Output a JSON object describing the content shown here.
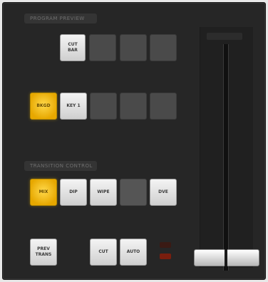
{
  "sections": {
    "top_label": "PROGRAM PREVIEW",
    "lower_label": "TRANSITION CONTROL"
  },
  "rows": {
    "row1": [
      {
        "label": "CUT\nBAR",
        "state": "lit"
      },
      {
        "label": "",
        "state": "dim"
      },
      {
        "label": "",
        "state": "dim"
      },
      {
        "label": "",
        "state": "dim"
      }
    ],
    "row2": [
      {
        "label": "BKGD",
        "state": "yellow"
      },
      {
        "label": "KEY 1",
        "state": "lit"
      },
      {
        "label": "",
        "state": "dim"
      },
      {
        "label": "",
        "state": "dim"
      },
      {
        "label": "",
        "state": "dim"
      }
    ],
    "row3": [
      {
        "label": "MIX",
        "state": "yellow"
      },
      {
        "label": "DIP",
        "state": "lit"
      },
      {
        "label": "WIPE",
        "state": "lit"
      },
      {
        "label": "",
        "state": "dim"
      },
      {
        "label": "DVE",
        "state": "lit"
      }
    ],
    "row4": [
      {
        "label": "PREV\nTRANS",
        "state": "lit"
      },
      {
        "label": "CUT",
        "state": "lit"
      },
      {
        "label": "AUTO",
        "state": "lit"
      }
    ]
  },
  "colors": {
    "panel": "#262626",
    "yellow": "#f2b800",
    "led_red": "#7a1e0e"
  },
  "tbar": {
    "name": "T-bar fader"
  }
}
